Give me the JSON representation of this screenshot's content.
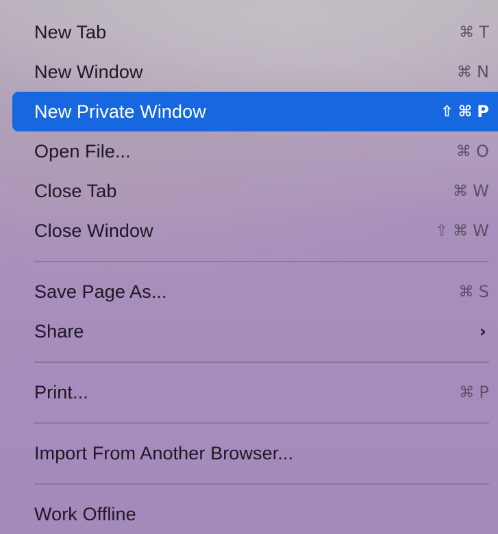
{
  "menu": {
    "items": [
      {
        "label": "New Tab",
        "shortcut_mod": "⌘",
        "shortcut_key": "T"
      },
      {
        "label": "New Window",
        "shortcut_mod": "⌘",
        "shortcut_key": "N"
      },
      {
        "label": "New Private Window",
        "shortcut_shift": "⇧",
        "shortcut_mod": "⌘",
        "shortcut_key": "P",
        "highlighted": true
      },
      {
        "label": "Open File...",
        "shortcut_mod": "⌘",
        "shortcut_key": "O"
      },
      {
        "label": "Close Tab",
        "shortcut_mod": "⌘",
        "shortcut_key": "W"
      },
      {
        "label": "Close Window",
        "shortcut_shift": "⇧",
        "shortcut_mod": "⌘",
        "shortcut_key": "W"
      },
      {
        "label": "Save Page As...",
        "shortcut_mod": "⌘",
        "shortcut_key": "S"
      },
      {
        "label": "Share",
        "submenu_arrow": "›"
      },
      {
        "label": "Print...",
        "shortcut_mod": "⌘",
        "shortcut_key": "P"
      },
      {
        "label": "Import From Another Browser..."
      },
      {
        "label": "Work Offline"
      }
    ]
  },
  "colors": {
    "highlight": "#1767e1",
    "text": "#1e1724",
    "shortcut_text": "#5b4f66",
    "background": "#a78ab8"
  },
  "icons": {
    "command": "command-icon",
    "shift": "shift-icon",
    "submenu": "chevron-right-icon"
  }
}
